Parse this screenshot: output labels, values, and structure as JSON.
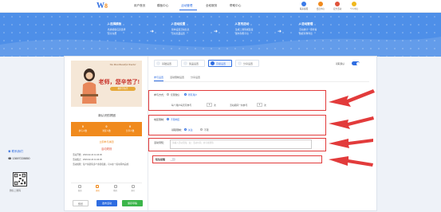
{
  "nav": {
    "logo_w": "W",
    "logo_num": "8",
    "items": [
      "用户首页",
      "模板中心",
      "活动管理",
      "全权服务",
      "帮助中心"
    ],
    "active_index": 2,
    "right_items": [
      {
        "label": "联系客服",
        "color": "#3b7be8"
      },
      {
        "label": "会员中心",
        "color": "#f08a1d"
      },
      {
        "label": "官方活动",
        "color": "#e0533a"
      },
      {
        "label": "个人中心",
        "color": "#f0b81d"
      }
    ]
  },
  "banner": {
    "steps": [
      {
        "title": "1.选择模板",
        "desc_1": "各类模板任意选择",
        "desc_2": "完全免费"
      },
      {
        "title": "2.活动设置",
        "desc_1": "简单设置活动信息",
        "desc_2": "活动奖品设置"
      },
      {
        "title": "3.发布活动",
        "desc_1": "生成二维码或链接",
        "desc_2": "发布到各平台"
      },
      {
        "title": "4.活动管理",
        "desc_1": "活动统计一键查看",
        "desc_2": "数据查询导出"
      }
    ]
  },
  "poster": {
    "headline": "The Most Beautiful Teacher",
    "big_text": "老师，您辛苦了!",
    "pill": "教师节快乐"
  },
  "group": {
    "title": "新认识的拼团",
    "subtitle": "",
    "stats": [
      {
        "value": "0",
        "label": "参与人数"
      },
      {
        "value": "0",
        "label": "浏览人数"
      },
      {
        "value": "0",
        "label": "分享人数"
      }
    ],
    "join_label": "立即参与拼团",
    "rules_title": "活动规则",
    "rules": [
      "活动开始：2023-02-22 11:44:36",
      "活动截止：2023-02-22 11:44:36",
      "活动规则：每个拼团有多个参团名额，可以在一段时间内完成"
    ],
    "tabs": [
      "首页",
      "拼团",
      "我的",
      "排行"
    ],
    "active_tab": 1,
    "buttons": [
      {
        "label": "预览",
        "bg": "#ffffff",
        "fg": "#666666",
        "border": "#cccccc"
      },
      {
        "label": "发布活动",
        "bg": "#2f6de1",
        "fg": "#ffffff",
        "border": "#2f6de1"
      },
      {
        "label": "保存草稿",
        "bg": "#3bb54a",
        "fg": "#ffffff",
        "border": "#3bb54a"
      }
    ]
  },
  "steps_bar": [
    {
      "label": "基础设置",
      "active": false
    },
    {
      "label": "奖品设置",
      "active": false
    },
    {
      "label": "高级设置",
      "active": true
    },
    {
      "label": "分享设置",
      "active": false
    }
  ],
  "toggle_label": "领取确认",
  "subtabs": [
    "参与设置",
    "活动限制设置",
    "分享设置"
  ],
  "form": {
    "limit_label": "参与方式：",
    "limit_opt_1": "仅限微信",
    "limit_opt_2": "所有用户",
    "count_label": "每个用户每天可参与",
    "count_value": "1",
    "count_unit": "次",
    "total_label": "活动期间一共参与",
    "total_value": "1",
    "total_unit": "次",
    "region_label": "地区限制：",
    "region_opt": "不限地区",
    "pay_label": "领取限制：",
    "pay_opt_1": "关注",
    "pay_opt_2": "不限",
    "notice_label": "活动须知：",
    "notice_placeholder": "请输入活动须知，如：活动时间、参与规则等",
    "sms_label": "短信提醒"
  },
  "contact": {
    "heading": "联系我们",
    "phone": "13697228850",
    "qr_caption": "微信二维码"
  },
  "colors": {
    "accent": "#2f6de1",
    "orange": "#f08a1d",
    "annotation": "#e23b3b"
  }
}
